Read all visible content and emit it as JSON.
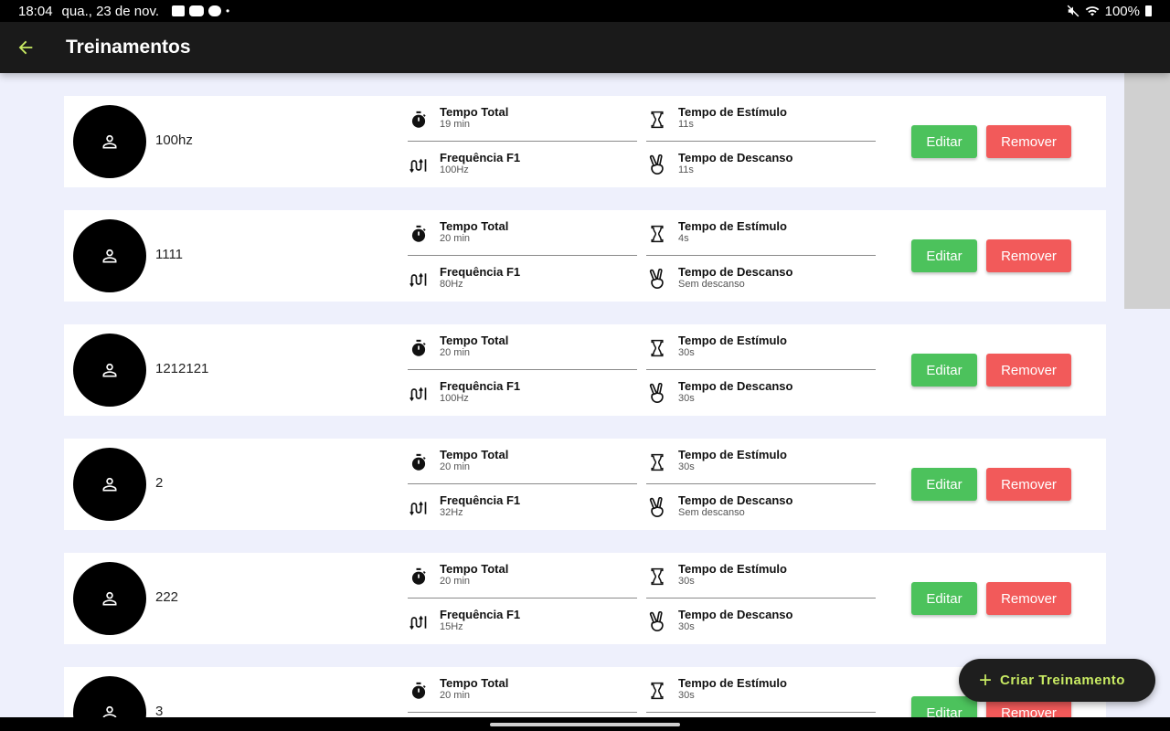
{
  "status_bar": {
    "time": "18:04",
    "date": "qua., 23 de nov.",
    "battery": "100%"
  },
  "app_bar": {
    "title": "Treinamentos"
  },
  "labels": {
    "tempo_total": "Tempo Total",
    "tempo_estimulo": "Tempo de Estímulo",
    "frequencia": "Frequência F1",
    "tempo_descanso": "Tempo de Descanso",
    "edit": "Editar",
    "remove": "Remover"
  },
  "trainings": [
    {
      "name": "100hz",
      "tempo_total": "19 min",
      "tempo_estimulo": "11s",
      "frequencia": "100Hz",
      "tempo_descanso": "11s"
    },
    {
      "name": "1111",
      "tempo_total": "20 min",
      "tempo_estimulo": "4s",
      "frequencia": "80Hz",
      "tempo_descanso": "Sem descanso"
    },
    {
      "name": "1212121",
      "tempo_total": "20 min",
      "tempo_estimulo": "30s",
      "frequencia": "100Hz",
      "tempo_descanso": "30s"
    },
    {
      "name": "2",
      "tempo_total": "20 min",
      "tempo_estimulo": "30s",
      "frequencia": "32Hz",
      "tempo_descanso": "Sem descanso"
    },
    {
      "name": "222",
      "tempo_total": "20 min",
      "tempo_estimulo": "30s",
      "frequencia": "15Hz",
      "tempo_descanso": "30s"
    },
    {
      "name": "3",
      "tempo_total": "20 min",
      "tempo_estimulo": "30s"
    }
  ],
  "fab": {
    "label": "Criar Treinamento"
  },
  "colors": {
    "edit": "#4cc25c",
    "remove": "#f25a5a",
    "accent": "#c8ea63",
    "app_bar": "#1a1a1a",
    "background": "#eef0fc"
  }
}
